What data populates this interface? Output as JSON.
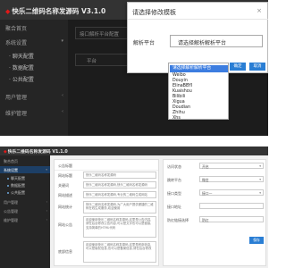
{
  "top": {
    "app_title": "快乐二维码名称发源码 V3.1.0",
    "sidebar": [
      {
        "label": "聚合首页",
        "chevron": ""
      },
      {
        "label": "系统设置",
        "chevron": "▾"
      },
      {
        "label": "· 聊天配置",
        "chevron": ""
      },
      {
        "label": "· 数据配置",
        "chevron": ""
      },
      {
        "label": "· 公共配置",
        "chevron": ""
      },
      {
        "label": "用户管理",
        "chevron": "‹"
      },
      {
        "label": "维护管理",
        "chevron": "‹"
      }
    ],
    "main_rows": [
      {
        "label": "接口解析平台配置"
      },
      {
        "label": "平台"
      }
    ],
    "modal": {
      "title": "请选择修改模板",
      "close": "×",
      "field_label": "解析平台",
      "select_value": "请选择解析解析平台",
      "confirm": "确定",
      "cancel": "取消"
    },
    "dropdown": [
      "请选择解析解析平台",
      "Weibo",
      "Douyin",
      "ElinaBBYI",
      "Kuaishou",
      "Bilibili",
      "Xigua",
      "Doudian",
      "Zhihu",
      "Xhs"
    ]
  },
  "bottom": {
    "app_title": "快乐二维码名称发源码 V1.1.0",
    "sidebar": [
      {
        "label": "聚合首页",
        "chevron": ""
      },
      {
        "label": "系统设置",
        "chevron": "▾",
        "active": true
      },
      {
        "label": "聊天配置",
        "chevron": "",
        "sub": true
      },
      {
        "label": "数据配置",
        "chevron": "",
        "sub": true
      },
      {
        "label": "公共配置",
        "chevron": "",
        "sub": true
      },
      {
        "label": "用户管理",
        "chevron": "‹"
      },
      {
        "label": "公告管理",
        "chevron": "‹"
      },
      {
        "label": "维护管理",
        "chevron": "‹"
      }
    ],
    "form_rows": [
      {
        "label": "公告标题",
        "value": ""
      },
      {
        "label": "网站标题",
        "value": "快乐二维码名称发源码 "
      },
      {
        "label": "关键词",
        "value": "快乐二维码名称发源码,快乐二维码名称发源码"
      },
      {
        "label": "网站描述",
        "value": "快乐二维码名称发源码,专业的二维码生成网站"
      },
      {
        "label": "网站统计",
        "value": "快乐二维码名称发源码,为广大用户提供便捷的二维码在线生成服务,欢迎使用"
      },
      {
        "label": "网站公告",
        "value": "欢迎使用快乐二维码名称发源码,这里是公告内容,请在后台修改公告内容,可以是文字也可以是链接,支持简单的HTML代码"
      },
      {
        "label": "底部信息",
        "value": "欢迎使用快乐二维码名称发源码,这里是底部信息,可以是版权信息,也可以是备案信息,请在后台修改"
      }
    ],
    "right_panel": {
      "rows": [
        {
          "label": "访问状态",
          "value": "开启"
        },
        {
          "label": "跳转平台",
          "value": "微信"
        },
        {
          "label": "接口类型",
          "value": "接口一"
        },
        {
          "label": "接口地址",
          "value": ""
        },
        {
          "label": "防红链接选择",
          "value": "防红"
        }
      ],
      "save": "保存"
    }
  },
  "colors": {
    "header_bg": "#333333",
    "sidebar_bg": "#252525",
    "accent_blue": "#2a7ed4",
    "dropdown_selected": "#3c7de0",
    "logo_red": "#e21919"
  }
}
